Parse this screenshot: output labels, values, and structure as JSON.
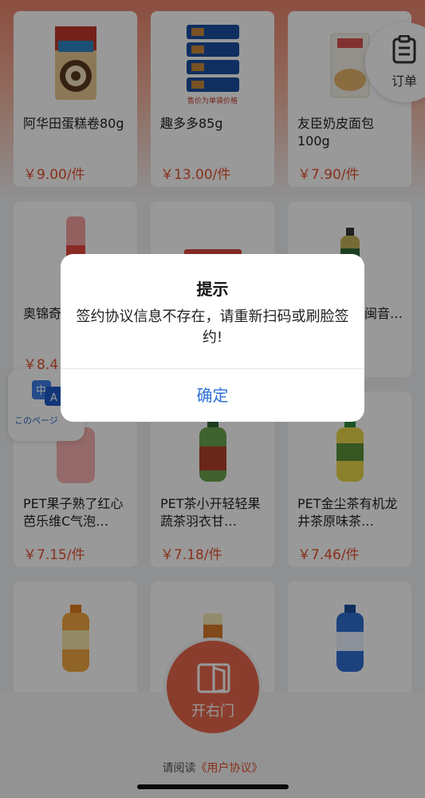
{
  "products": [
    {
      "name": "阿华田蛋糕卷80g",
      "price": "￥9.00/件"
    },
    {
      "name": "趣多多85g",
      "price": "￥13.00/件"
    },
    {
      "name": "友臣奶皮面包100g",
      "price": "￥7.90/件"
    },
    {
      "name": "奥锦奇肉丝肠",
      "price": "￥8.4"
    },
    {
      "name": "",
      "price": ""
    },
    {
      "name": "人闽音…",
      "price": ""
    },
    {
      "name": "PET果子熟了红心芭乐维C气泡…",
      "price": "￥7.15/件"
    },
    {
      "name": "PET茶小开轻轻果蔬茶羽衣甘…",
      "price": "￥7.18/件"
    },
    {
      "name": "PET金尘茶有机龙井茶原味茶…",
      "price": "￥7.46/件"
    },
    {
      "name": "",
      "price": ""
    },
    {
      "name": "",
      "price": ""
    },
    {
      "name": "",
      "price": ""
    }
  ],
  "product_img_caption": "售价为单袋价格",
  "order_button": {
    "label": "订单"
  },
  "translate": {
    "label": "このページ",
    "zh": "中",
    "en": "A"
  },
  "open_door": {
    "label": "开右门"
  },
  "agreement": {
    "prefix": "请阅读",
    "link": "《用户协议》"
  },
  "dialog": {
    "title": "提示",
    "message": "签约协议信息不存在，请重新扫码或刷脸签约!",
    "confirm": "确定"
  },
  "colors": {
    "accent": "#e7664b",
    "price": "#e4512f",
    "link_blue": "#2b6fd6"
  }
}
